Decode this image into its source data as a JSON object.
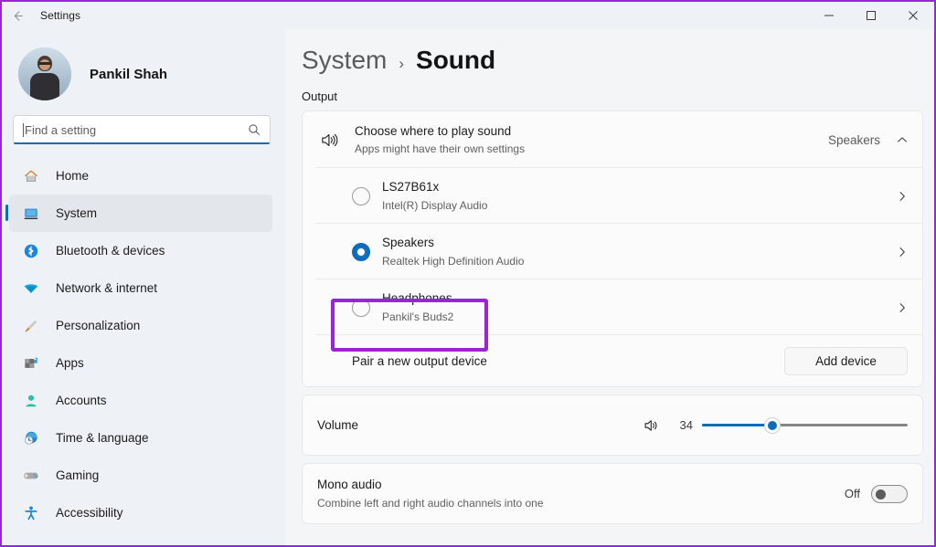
{
  "window": {
    "title": "Settings",
    "back_icon": "back-arrow-icon",
    "minimize_label": "—",
    "maximize_label": "□",
    "close_label": "✕"
  },
  "sidebar": {
    "profile": {
      "name": "Pankil Shah",
      "avatar": "user-avatar"
    },
    "search": {
      "value": "",
      "placeholder": "Find a setting",
      "icon": "search-icon"
    },
    "items": [
      {
        "label": "Home",
        "icon": "home-icon",
        "selected": false
      },
      {
        "label": "System",
        "icon": "system-icon",
        "selected": true
      },
      {
        "label": "Bluetooth & devices",
        "icon": "bluetooth-icon",
        "selected": false
      },
      {
        "label": "Network & internet",
        "icon": "wifi-icon",
        "selected": false
      },
      {
        "label": "Personalization",
        "icon": "paintbrush-icon",
        "selected": false
      },
      {
        "label": "Apps",
        "icon": "apps-icon",
        "selected": false
      },
      {
        "label": "Accounts",
        "icon": "account-icon",
        "selected": false
      },
      {
        "label": "Time & language",
        "icon": "clock-icon",
        "selected": false
      },
      {
        "label": "Gaming",
        "icon": "gamepad-icon",
        "selected": false
      },
      {
        "label": "Accessibility",
        "icon": "accessibility-icon",
        "selected": false
      }
    ]
  },
  "main": {
    "breadcrumb": {
      "parent": "System",
      "separator": "›",
      "current": "Sound"
    },
    "section_output_label": "Output",
    "choose_row": {
      "icon": "speaker-icon",
      "title": "Choose where to play sound",
      "subtitle": "Apps might have their own settings",
      "value": "Speakers",
      "chevron": "chevron-up-icon"
    },
    "devices": [
      {
        "name": "LS27B61x",
        "driver": "Intel(R) Display Audio",
        "selected": false,
        "chevron": "chevron-right-icon"
      },
      {
        "name": "Speakers",
        "driver": "Realtek High Definition Audio",
        "selected": true,
        "chevron": "chevron-right-icon"
      },
      {
        "name": "Headphones",
        "driver": "Pankil's Buds2",
        "selected": false,
        "chevron": "chevron-right-icon"
      }
    ],
    "pair_row": {
      "label": "Pair a new output device",
      "button": "Add device"
    },
    "volume_row": {
      "label": "Volume",
      "icon": "speaker-icon",
      "value": "34",
      "percent": 34
    },
    "mono_row": {
      "title": "Mono audio",
      "subtitle": "Combine left and right audio channels into one",
      "state_label": "Off",
      "on": false
    }
  },
  "annotation": {
    "highlight_target": "Headphones",
    "color": "#9b25d6"
  }
}
